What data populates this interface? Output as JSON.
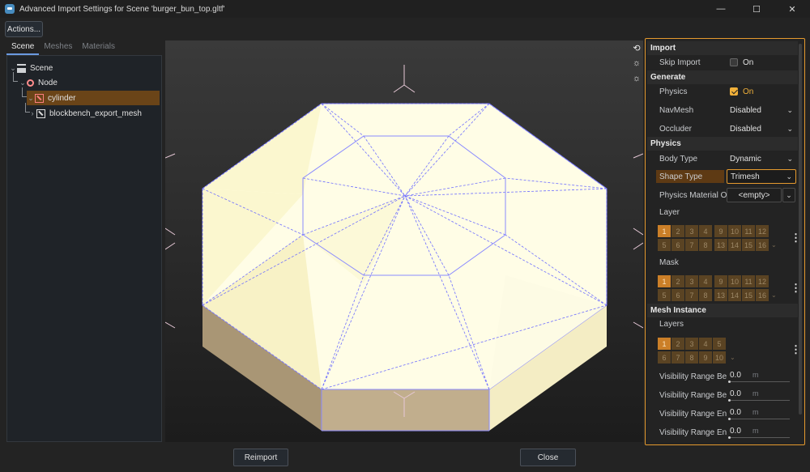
{
  "window": {
    "title": "Advanced Import Settings for Scene 'burger_bun_top.gltf'",
    "minimize": "—",
    "maximize": "☐",
    "close": "✕"
  },
  "toolbar": {
    "actions_label": "Actions..."
  },
  "tabs": [
    {
      "label": "Scene",
      "active": true
    },
    {
      "label": "Meshes",
      "active": false
    },
    {
      "label": "Materials",
      "active": false
    }
  ],
  "tree": {
    "items": [
      {
        "label": "Scene",
        "icon": "scene-icon"
      },
      {
        "label": "Node",
        "icon": "node-icon"
      },
      {
        "label": "cylinder",
        "icon": "mesh-instance-icon",
        "selected": true
      },
      {
        "label": "blockbench_export_mesh",
        "icon": "mesh-icon"
      }
    ]
  },
  "viewport": {
    "icons": [
      "rotate-light-icon",
      "light-1-icon",
      "light-2-icon"
    ]
  },
  "inspector": {
    "import": {
      "header": "Import",
      "skip_import_label": "Skip Import",
      "skip_import_value": "On",
      "skip_import_checked": false
    },
    "generate": {
      "header": "Generate",
      "physics_label": "Physics",
      "physics_value": "On",
      "physics_checked": true,
      "navmesh_label": "NavMesh",
      "navmesh_value": "Disabled",
      "occluder_label": "Occluder",
      "occluder_value": "Disabled"
    },
    "physics": {
      "header": "Physics",
      "body_type_label": "Body Type",
      "body_type_value": "Dynamic",
      "shape_type_label": "Shape Type",
      "shape_type_value": "Trimesh",
      "physics_material_label": "Physics Material O",
      "physics_material_value": "<empty>",
      "layer_label": "Layer",
      "layer_active": [
        1
      ],
      "mask_label": "Mask",
      "mask_active": [
        1
      ]
    },
    "mesh_instance": {
      "header": "Mesh Instance",
      "layers_label": "Layers",
      "layers_active": [
        1
      ],
      "vis_range_begin_label": "Visibility Range Be",
      "vis_range_begin_value": "0.0",
      "vis_range_begin_margin_label": "Visibility Range Be",
      "vis_range_begin_margin_value": "0.0",
      "vis_range_end_label": "Visibility Range En",
      "vis_range_end_value": "0.0",
      "vis_range_end_margin_label": "Visibility Range En",
      "vis_range_end_margin_value": "0.0",
      "unit": "m"
    },
    "layer_numbers_top": [
      "1",
      "2",
      "3",
      "4",
      "9",
      "10",
      "11",
      "12"
    ],
    "layer_numbers_bottom": [
      "5",
      "6",
      "7",
      "8",
      "13",
      "14",
      "15",
      "16"
    ],
    "render_layer_top": [
      "1",
      "2",
      "3",
      "4",
      "5"
    ],
    "render_layer_bottom": [
      "6",
      "7",
      "8",
      "9",
      "10"
    ]
  },
  "footer": {
    "reimport_label": "Reimport",
    "close_label": "Close"
  },
  "colors": {
    "accent": "#e59a2e",
    "selected_row": "#6a4418",
    "active_cell": "#cb7f28",
    "mesh_top": "#fffdea",
    "mesh_side": "#bda987"
  }
}
